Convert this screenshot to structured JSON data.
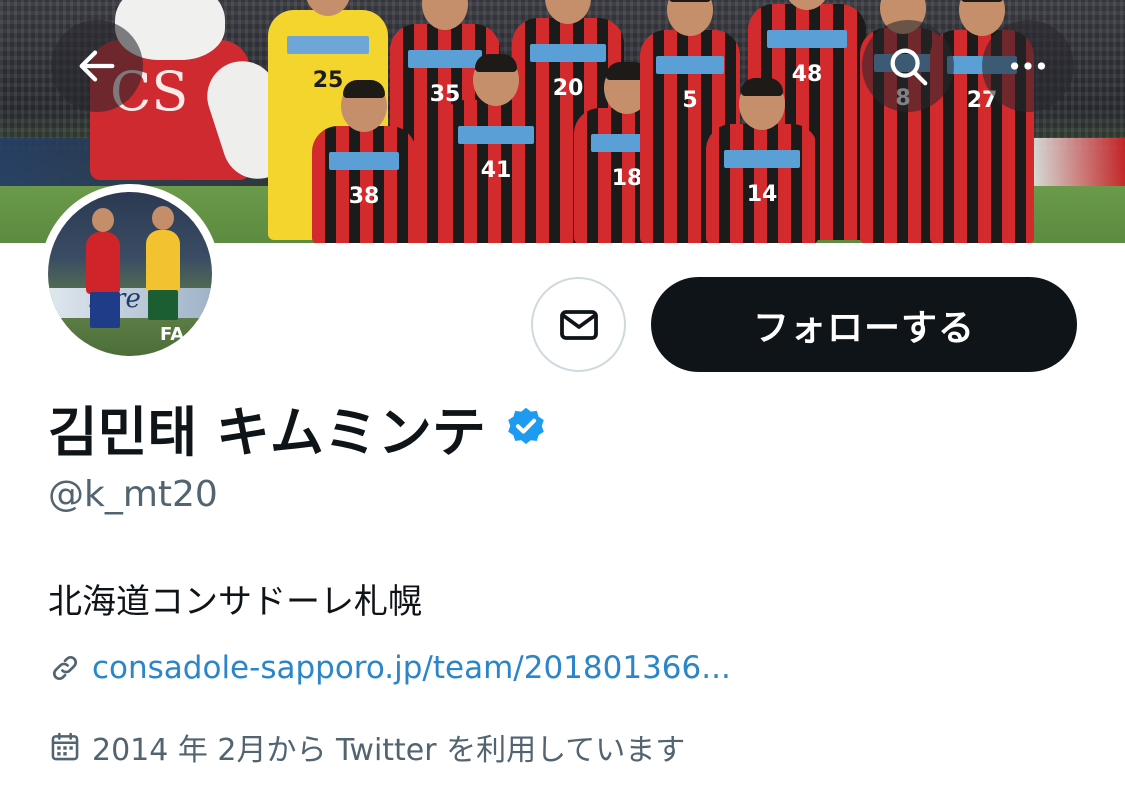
{
  "profile": {
    "display_name": "김민태 キムミンテ",
    "handle": "@k_mt20",
    "bio": "北海道コンサドーレ札幌",
    "website": "consadole-sapporo.jp/team/201801366...",
    "joined": "2014 年 2月から Twitter を利用しています",
    "verified": true
  },
  "actions": {
    "follow_label": "フォローする"
  },
  "icons": {
    "back": "arrow-left-icon",
    "search": "search-icon",
    "more": "more-dots-icon",
    "message": "mail-icon",
    "verified": "verified-badge-icon",
    "link": "link-icon",
    "calendar": "calendar-icon"
  },
  "banner": {
    "player_numbers": [
      "25",
      "35",
      "20",
      "48",
      "38",
      "41",
      "18",
      "5",
      "14",
      "8",
      "27"
    ],
    "mascot_letters": "CS",
    "avatar_text": "hire",
    "avatar_corner": "FA"
  },
  "colors": {
    "accent": "#1d9bf0",
    "follow_button": "#0f1419",
    "secondary_text": "#536471",
    "verified": "#1d9bf0"
  }
}
